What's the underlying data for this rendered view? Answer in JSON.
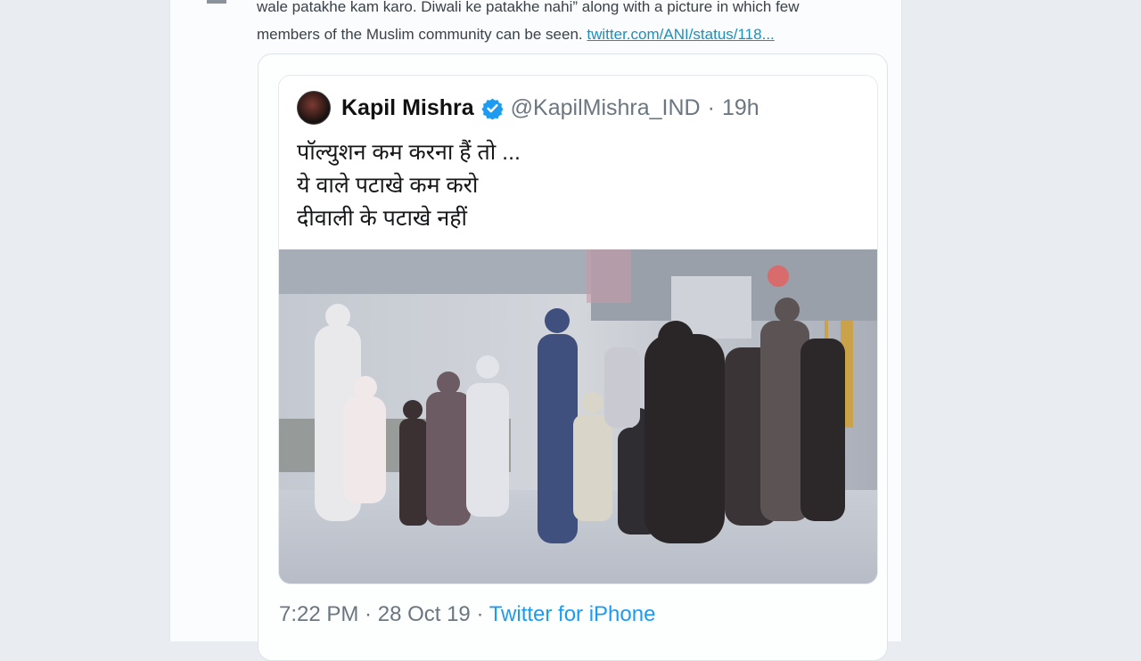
{
  "lead": {
    "line1": "wale patakhe kam karo. Diwali ke patakhe nahi” along with a picture in which few",
    "line2": "members of the Muslim community can be seen.",
    "link": "twitter.com/ANI/status/118..."
  },
  "quoted_tweet": {
    "author": "Kapil Mishra",
    "handle": "@KapilMishra_IND",
    "separator": "·",
    "time": "19h",
    "lines": [
      "पॉल्युशन कम करना हैं तो ...",
      "ये वाले पटाखे कम करो",
      "दीवाली के पटाखे नहीं"
    ],
    "verified_color": "#1d9bf0"
  },
  "meta": {
    "time": "7:22 PM",
    "separator1": " · ",
    "date": "28 Oct 19",
    "separator2": " · ",
    "source": "Twitter for iPhone"
  },
  "icons": [
    "verified-badge-icon"
  ]
}
